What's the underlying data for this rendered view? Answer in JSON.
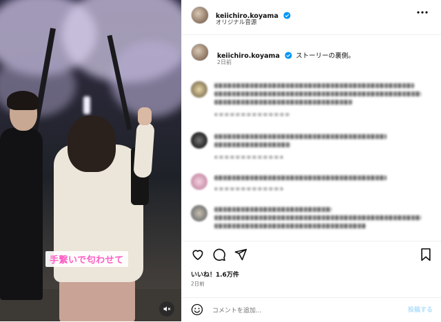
{
  "video": {
    "caption_overlay": "手繋いで匂わせて",
    "mute_icon": "speaker-muted-icon"
  },
  "header": {
    "username": "keiichiro.koyama",
    "audio": "オリジナル音源",
    "verified_icon": "verified-badge-icon",
    "more_icon": "more-horizontal-icon"
  },
  "post_caption": {
    "username": "keiichiro.koyama",
    "text": "ストーリーの裏側。",
    "time": "2日前"
  },
  "actions": {
    "like_icon": "heart-icon",
    "comment_icon": "comment-icon",
    "share_icon": "send-icon",
    "save_icon": "bookmark-icon"
  },
  "likes_text": "いいね！1.6万件",
  "posted_time": "2日前",
  "comment_box": {
    "emoji_icon": "emoji-icon",
    "placeholder": "コメントを追加...",
    "post_label": "投稿する"
  },
  "colors": {
    "verified": "#0095f6",
    "caption_pink": "#ff5ec4",
    "post_disabled": "#b2dffc"
  }
}
